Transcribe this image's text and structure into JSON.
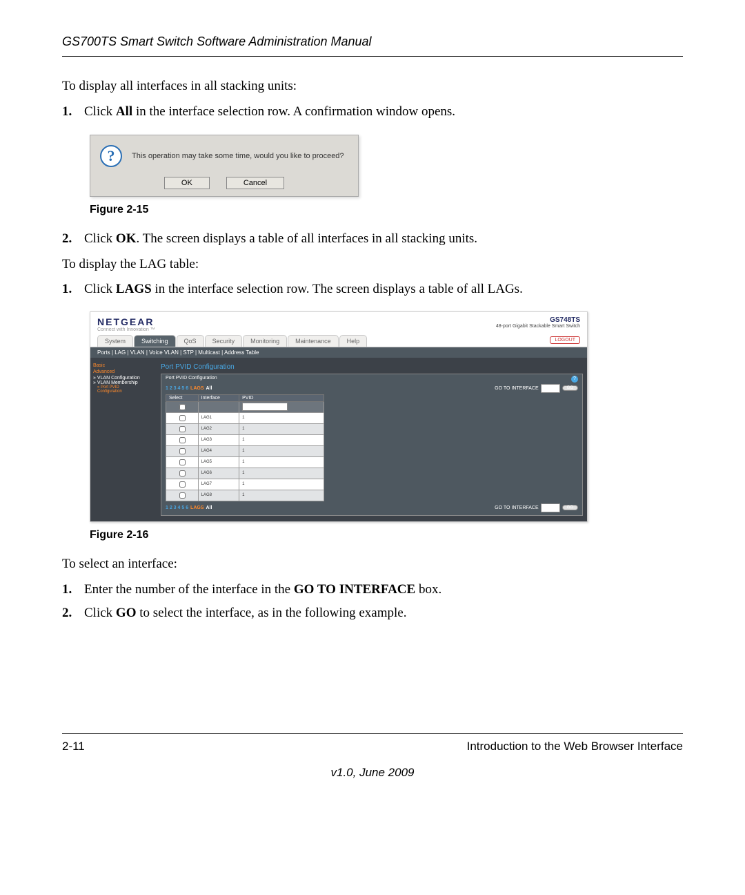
{
  "header": "GS700TS Smart Switch Software Administration Manual",
  "p1": "To display all interfaces  in all stacking units:",
  "step1a_num": "1.",
  "step1a_pre": "Click ",
  "step1a_bold": "All",
  "step1a_post": " in the interface selection row. A confirmation window opens.",
  "dialog": {
    "msg": "This operation may take some time, would you like to proceed?",
    "ok": "OK",
    "cancel": "Cancel"
  },
  "fig15": "Figure 2-15",
  "step2a_num": "2.",
  "step2a_pre": "Click ",
  "step2a_bold": "OK",
  "step2a_post": ". The screen displays a table of all interfaces  in all stacking units.",
  "p2": "To display the LAG table:",
  "step1b_num": "1.",
  "step1b_pre": "Click ",
  "step1b_bold": "LAGS",
  "step1b_post": " in the interface selection row. The screen displays a table of all LAGs.",
  "ng": {
    "logo": "NETGEAR",
    "tagline": "Connect with Innovation ™",
    "model": "GS748TS",
    "model_sub": "48-port Gigabit Stackable Smart Switch",
    "tabs": [
      "System",
      "Switching",
      "QoS",
      "Security",
      "Monitoring",
      "Maintenance",
      "Help"
    ],
    "logout": "LOGOUT",
    "subtabs": "Ports | LAG | VLAN | Voice VLAN | STP | Multicast | Address Table",
    "side": {
      "basic": "Basic",
      "advanced": "Advanced",
      "vlan_conf": "» VLAN Configuration",
      "vlan_memb": "» VLAN Membership",
      "port_pvid": "» Port PVID",
      "port_pvid2": "Configuration"
    },
    "title": "Port PVID Configuration",
    "panel_title": "Port PVID Configuration",
    "sel": {
      "nums": "1 2 3 4 5 6",
      "lags": "LAGS",
      "all": "All",
      "goto": "GO TO INTERFACE",
      "go": "GO"
    },
    "cols": {
      "select": "Select",
      "iface": "Interface",
      "pvid": "PVID"
    },
    "rows": [
      {
        "iface": "LAG1",
        "pvid": "1"
      },
      {
        "iface": "LAG2",
        "pvid": "1"
      },
      {
        "iface": "LAG3",
        "pvid": "1"
      },
      {
        "iface": "LAG4",
        "pvid": "1"
      },
      {
        "iface": "LAG5",
        "pvid": "1"
      },
      {
        "iface": "LAG6",
        "pvid": "1"
      },
      {
        "iface": "LAG7",
        "pvid": "1"
      },
      {
        "iface": "LAG8",
        "pvid": "1"
      }
    ]
  },
  "fig16": "Figure 2-16",
  "p3": "To select an interface:",
  "step1c_num": "1.",
  "step1c_pre": "Enter the number of the interface in the ",
  "step1c_bold": "GO TO INTERFACE",
  "step1c_post": " box.",
  "step2c_num": "2.",
  "step2c_pre": "Click ",
  "step2c_bold": "GO",
  "step2c_post": " to select the interface, as in the following example.",
  "footer": {
    "left": "2-11",
    "right": "Introduction to the Web Browser Interface",
    "center": "v1.0, June 2009"
  }
}
